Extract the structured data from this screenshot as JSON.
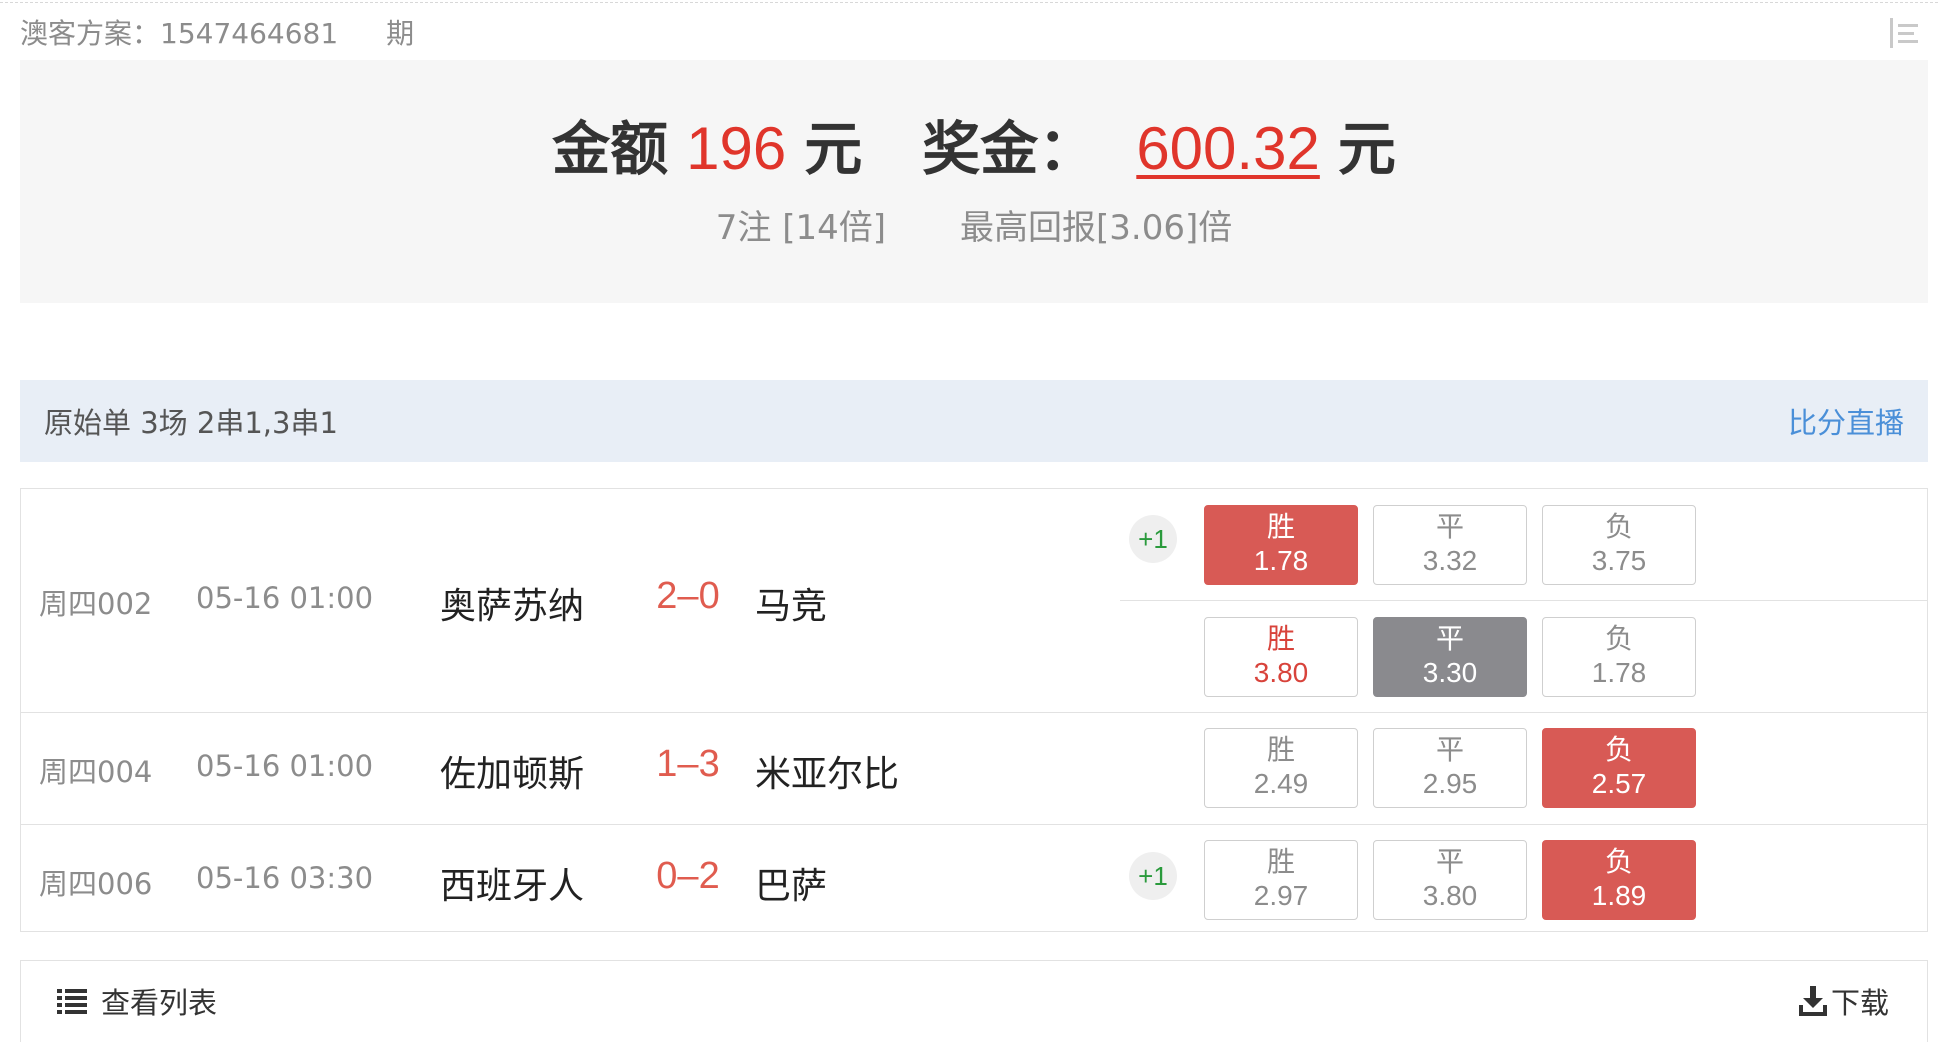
{
  "header": {
    "scheme_label": "澳客方案：1547464681",
    "period_label": "期"
  },
  "summary": {
    "amount_label": "金额",
    "amount_value": "196",
    "amount_unit": "元",
    "prize_label": "奖金：",
    "prize_value": "600.32",
    "prize_unit": "元",
    "bets": "7注 [14倍]",
    "max_return": "最高回报[3.06]倍"
  },
  "order": {
    "description": "原始单 3场 2串1,3串1",
    "live_link": "比分直播"
  },
  "matches": [
    {
      "code": "周四002",
      "time": "05-16 01:00",
      "home": "奥萨苏纳",
      "score": "2–0",
      "away": "马竞",
      "handicap": "+1",
      "odds_rows": [
        [
          {
            "label": "胜",
            "value": "1.78",
            "state": "selected-red"
          },
          {
            "label": "平",
            "value": "3.32",
            "state": "normal"
          },
          {
            "label": "负",
            "value": "3.75",
            "state": "normal"
          }
        ],
        [
          {
            "label": "胜",
            "value": "3.80",
            "state": "result-red-text"
          },
          {
            "label": "平",
            "value": "3.30",
            "state": "selected-gray"
          },
          {
            "label": "负",
            "value": "1.78",
            "state": "normal"
          }
        ]
      ]
    },
    {
      "code": "周四004",
      "time": "05-16 01:00",
      "home": "佐加顿斯",
      "score": "1–3",
      "away": "米亚尔比",
      "handicap": "",
      "odds_rows": [
        [
          {
            "label": "胜",
            "value": "2.49",
            "state": "normal"
          },
          {
            "label": "平",
            "value": "2.95",
            "state": "normal"
          },
          {
            "label": "负",
            "value": "2.57",
            "state": "selected-red"
          }
        ]
      ]
    },
    {
      "code": "周四006",
      "time": "05-16 03:30",
      "home": "西班牙人",
      "score": "0–2",
      "away": "巴萨",
      "handicap": "+1",
      "odds_rows": [
        [
          {
            "label": "胜",
            "value": "2.97",
            "state": "normal"
          },
          {
            "label": "平",
            "value": "3.80",
            "state": "normal"
          },
          {
            "label": "负",
            "value": "1.89",
            "state": "selected-red"
          }
        ]
      ]
    }
  ],
  "footer": {
    "list_label": "查看列表",
    "list_icon": "list-icon",
    "download_label": "下载",
    "download_icon": "download-icon"
  },
  "colors": {
    "accent_red": "#e0352b",
    "selected_red": "#d85a55",
    "selected_gray": "#8a8a8e",
    "link_blue": "#4a8fd8",
    "handicap_green": "#2a9a3c"
  }
}
